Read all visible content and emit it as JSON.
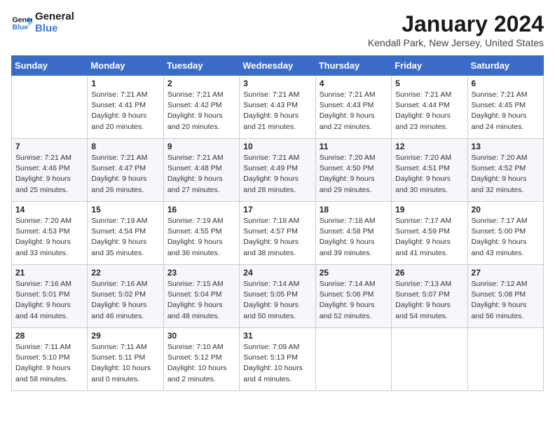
{
  "logo": {
    "line1": "General",
    "line2": "Blue"
  },
  "title": "January 2024",
  "subtitle": "Kendall Park, New Jersey, United States",
  "weekdays": [
    "Sunday",
    "Monday",
    "Tuesday",
    "Wednesday",
    "Thursday",
    "Friday",
    "Saturday"
  ],
  "weeks": [
    [
      {
        "num": "",
        "info": ""
      },
      {
        "num": "1",
        "info": "Sunrise: 7:21 AM\nSunset: 4:41 PM\nDaylight: 9 hours\nand 20 minutes."
      },
      {
        "num": "2",
        "info": "Sunrise: 7:21 AM\nSunset: 4:42 PM\nDaylight: 9 hours\nand 20 minutes."
      },
      {
        "num": "3",
        "info": "Sunrise: 7:21 AM\nSunset: 4:43 PM\nDaylight: 9 hours\nand 21 minutes."
      },
      {
        "num": "4",
        "info": "Sunrise: 7:21 AM\nSunset: 4:43 PM\nDaylight: 9 hours\nand 22 minutes."
      },
      {
        "num": "5",
        "info": "Sunrise: 7:21 AM\nSunset: 4:44 PM\nDaylight: 9 hours\nand 23 minutes."
      },
      {
        "num": "6",
        "info": "Sunrise: 7:21 AM\nSunset: 4:45 PM\nDaylight: 9 hours\nand 24 minutes."
      }
    ],
    [
      {
        "num": "7",
        "info": "Sunrise: 7:21 AM\nSunset: 4:46 PM\nDaylight: 9 hours\nand 25 minutes."
      },
      {
        "num": "8",
        "info": "Sunrise: 7:21 AM\nSunset: 4:47 PM\nDaylight: 9 hours\nand 26 minutes."
      },
      {
        "num": "9",
        "info": "Sunrise: 7:21 AM\nSunset: 4:48 PM\nDaylight: 9 hours\nand 27 minutes."
      },
      {
        "num": "10",
        "info": "Sunrise: 7:21 AM\nSunset: 4:49 PM\nDaylight: 9 hours\nand 28 minutes."
      },
      {
        "num": "11",
        "info": "Sunrise: 7:20 AM\nSunset: 4:50 PM\nDaylight: 9 hours\nand 29 minutes."
      },
      {
        "num": "12",
        "info": "Sunrise: 7:20 AM\nSunset: 4:51 PM\nDaylight: 9 hours\nand 30 minutes."
      },
      {
        "num": "13",
        "info": "Sunrise: 7:20 AM\nSunset: 4:52 PM\nDaylight: 9 hours\nand 32 minutes."
      }
    ],
    [
      {
        "num": "14",
        "info": "Sunrise: 7:20 AM\nSunset: 4:53 PM\nDaylight: 9 hours\nand 33 minutes."
      },
      {
        "num": "15",
        "info": "Sunrise: 7:19 AM\nSunset: 4:54 PM\nDaylight: 9 hours\nand 35 minutes."
      },
      {
        "num": "16",
        "info": "Sunrise: 7:19 AM\nSunset: 4:55 PM\nDaylight: 9 hours\nand 36 minutes."
      },
      {
        "num": "17",
        "info": "Sunrise: 7:18 AM\nSunset: 4:57 PM\nDaylight: 9 hours\nand 38 minutes."
      },
      {
        "num": "18",
        "info": "Sunrise: 7:18 AM\nSunset: 4:58 PM\nDaylight: 9 hours\nand 39 minutes."
      },
      {
        "num": "19",
        "info": "Sunrise: 7:17 AM\nSunset: 4:59 PM\nDaylight: 9 hours\nand 41 minutes."
      },
      {
        "num": "20",
        "info": "Sunrise: 7:17 AM\nSunset: 5:00 PM\nDaylight: 9 hours\nand 43 minutes."
      }
    ],
    [
      {
        "num": "21",
        "info": "Sunrise: 7:16 AM\nSunset: 5:01 PM\nDaylight: 9 hours\nand 44 minutes."
      },
      {
        "num": "22",
        "info": "Sunrise: 7:16 AM\nSunset: 5:02 PM\nDaylight: 9 hours\nand 46 minutes."
      },
      {
        "num": "23",
        "info": "Sunrise: 7:15 AM\nSunset: 5:04 PM\nDaylight: 9 hours\nand 48 minutes."
      },
      {
        "num": "24",
        "info": "Sunrise: 7:14 AM\nSunset: 5:05 PM\nDaylight: 9 hours\nand 50 minutes."
      },
      {
        "num": "25",
        "info": "Sunrise: 7:14 AM\nSunset: 5:06 PM\nDaylight: 9 hours\nand 52 minutes."
      },
      {
        "num": "26",
        "info": "Sunrise: 7:13 AM\nSunset: 5:07 PM\nDaylight: 9 hours\nand 54 minutes."
      },
      {
        "num": "27",
        "info": "Sunrise: 7:12 AM\nSunset: 5:08 PM\nDaylight: 9 hours\nand 56 minutes."
      }
    ],
    [
      {
        "num": "28",
        "info": "Sunrise: 7:11 AM\nSunset: 5:10 PM\nDaylight: 9 hours\nand 58 minutes."
      },
      {
        "num": "29",
        "info": "Sunrise: 7:11 AM\nSunset: 5:11 PM\nDaylight: 10 hours\nand 0 minutes."
      },
      {
        "num": "30",
        "info": "Sunrise: 7:10 AM\nSunset: 5:12 PM\nDaylight: 10 hours\nand 2 minutes."
      },
      {
        "num": "31",
        "info": "Sunrise: 7:09 AM\nSunset: 5:13 PM\nDaylight: 10 hours\nand 4 minutes."
      },
      {
        "num": "",
        "info": ""
      },
      {
        "num": "",
        "info": ""
      },
      {
        "num": "",
        "info": ""
      }
    ]
  ]
}
